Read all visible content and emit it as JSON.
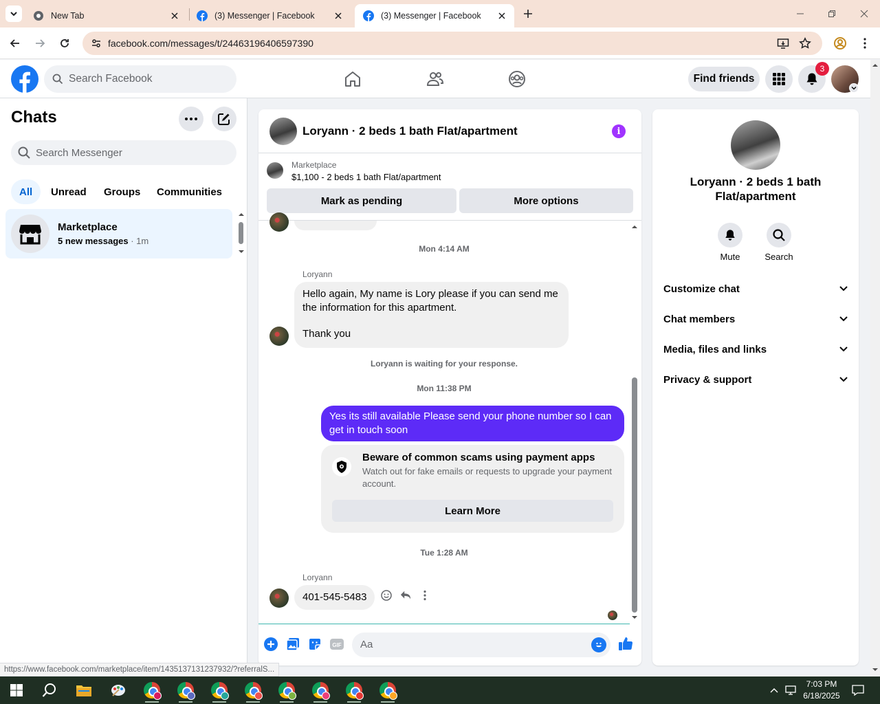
{
  "browser": {
    "tabs": [
      {
        "title": "New Tab"
      },
      {
        "title": "(3) Messenger | Facebook"
      },
      {
        "title": "(3) Messenger | Facebook"
      }
    ],
    "url": "facebook.com/messages/t/24463196406597390",
    "status_url": "https://www.facebook.com/marketplace/item/1435137131237932/?referralS..."
  },
  "fb_header": {
    "search_placeholder": "Search Facebook",
    "find_friends_label": "Find friends",
    "notification_count": "3"
  },
  "chats": {
    "title": "Chats",
    "search_placeholder": "Search Messenger",
    "filters": [
      "All",
      "Unread",
      "Groups",
      "Communities"
    ],
    "items": [
      {
        "name": "Marketplace",
        "preview": "5 new messages",
        "time": " · 1m"
      }
    ]
  },
  "conversation": {
    "title": "Loryann · 2 beds 1 bath Flat/apartment",
    "marketplace_label": "Marketplace",
    "listing": "$1,100 - 2 beds 1 bath Flat/apartment",
    "mark_pending_label": "Mark as pending",
    "more_options_label": "More options",
    "timestamp_1": "Mon 4:14 AM",
    "sender_1": "Loryann",
    "message_1_line1": "Hello again, My name is Lory please if you can send me the information for this apartment.",
    "message_1_line2": "Thank you",
    "waiting_notice": "Loryann is waiting for your response.",
    "timestamp_2": "Mon 11:38 PM",
    "outgoing_message": "Yes its still available Please send your phone number so I can get in touch soon",
    "scam_title": "Beware of common scams using payment apps",
    "scam_desc": "Watch out for fake emails or requests to upgrade your payment account.",
    "learn_more_label": "Learn More",
    "timestamp_3": "Tue 1:28 AM",
    "sender_2": "Loryann",
    "message_2": "401-545-5483",
    "composer_placeholder": "Aa"
  },
  "info_panel": {
    "name": "Loryann · 2 beds 1 bath Flat/apartment",
    "mute_label": "Mute",
    "search_label": "Search",
    "sections": [
      "Customize chat",
      "Chat members",
      "Media, files and links",
      "Privacy & support"
    ]
  },
  "taskbar": {
    "time": "7:03 PM",
    "date": "6/18/2025"
  },
  "colors": {
    "fb_blue": "#1877f2",
    "outgoing_bubble": "#5d2bf7",
    "info_purple": "#a033ff",
    "badge_red": "#e41e3f"
  }
}
